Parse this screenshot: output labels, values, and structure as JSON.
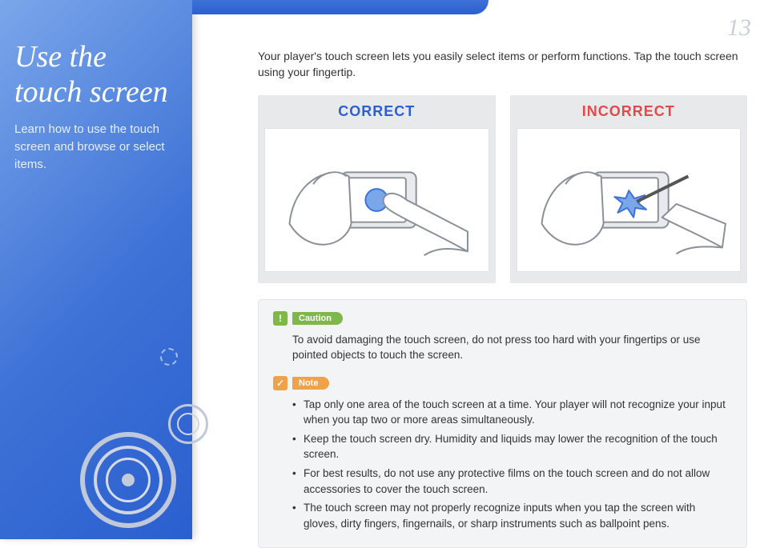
{
  "page_number": "13",
  "sidebar": {
    "title_line1": "Use the",
    "title_line2": "touch screen",
    "subtitle": "Learn how to use the touch screen and browse or select items."
  },
  "intro": "Your player's touch screen lets you easily select items or perform functions. Tap the touch screen using your fingertip.",
  "figures": {
    "correct_label": "CORRECT",
    "incorrect_label": "INCORRECT"
  },
  "caution": {
    "badge": "Caution",
    "text": "To avoid damaging the touch screen, do not press too hard with your fingertips or use pointed objects to touch the screen."
  },
  "note": {
    "badge": "Note",
    "items": [
      "Tap only one area of the touch screen at a time. Your player will not recognize your input when you tap two or more areas simultaneously.",
      "Keep the touch screen dry. Humidity and liquids may lower the recognition of the touch screen.",
      "For best results, do not use any protective films on the touch screen and do not allow accessories to cover the touch screen.",
      "The touch screen may not properly recognize inputs when you tap the screen with gloves, dirty fingers, fingernails, or sharp instruments such as ballpoint pens."
    ]
  }
}
